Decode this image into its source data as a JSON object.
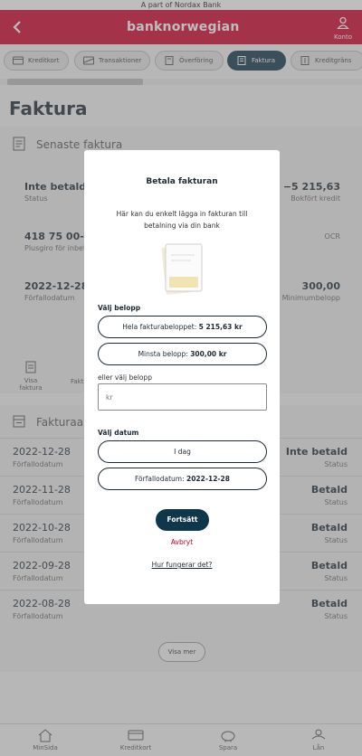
{
  "top_banner": "A part of Nordax Bank",
  "header": {
    "brand": "banknorwegian",
    "account_label": "Konto",
    "brand_color": "#d0002a"
  },
  "tabs": [
    {
      "label": "Kreditkort",
      "icon": "credit-card-icon"
    },
    {
      "label": "Transaktioner",
      "icon": "transactions-icon"
    },
    {
      "label": "Överföring",
      "icon": "transfer-icon"
    },
    {
      "label": "Faktura",
      "icon": "invoice-icon",
      "active": true
    },
    {
      "label": "Kreditgräns",
      "icon": "credit-limit-icon"
    }
  ],
  "page_title": "Faktura",
  "latest_invoice": {
    "title": "Senaste faktura",
    "status_value": "Inte betald",
    "status_label": "Status",
    "booked_value": "−5 215,63",
    "booked_label": "Bokfört kredit",
    "plusgiro_value": "418 75 00-6",
    "plusgiro_label": "Plusgiro för inbetalning",
    "ocr_label": "OCR",
    "due_value": "2022-12-28",
    "due_label": "Förfallodatum",
    "min_value": "300,00",
    "min_label": "Minimumbelopp",
    "action_show": "Visa faktura",
    "action_partial": "Fakt"
  },
  "archive": {
    "title": "Fakturaarkiv",
    "rows": [
      {
        "date": "2022-12-28",
        "date_label": "Förfallodatum",
        "status": "Inte betald",
        "status_label": "Status"
      },
      {
        "date": "2022-11-28",
        "date_label": "Förfallodatum",
        "status": "Betald",
        "status_label": "Status"
      },
      {
        "date": "2022-10-28",
        "date_label": "Förfallodatum",
        "status": "Betald",
        "status_label": "Status"
      },
      {
        "date": "2022-09-28",
        "date_label": "Förfallodatum",
        "status": "Betald",
        "status_label": "Status"
      },
      {
        "date": "2022-08-28",
        "date_label": "Förfallodatum",
        "status": "Betald",
        "status_label": "Status"
      }
    ],
    "show_more": "Visa mer"
  },
  "bottom_nav": [
    {
      "label": "MinSida",
      "icon": "home-icon"
    },
    {
      "label": "Kreditkort",
      "icon": "credit-card-icon"
    },
    {
      "label": "Spara",
      "icon": "piggy-bank-icon"
    },
    {
      "label": "Lån",
      "icon": "loan-icon"
    }
  ],
  "modal": {
    "title": "Betala fakturan",
    "description": "Här kan du enkelt lägga in fakturan till betalning via din bank",
    "choose_amount_label": "Välj belopp",
    "full_amount_prefix": "Hela fakturabeloppet:",
    "full_amount_value": "5 215,63 kr",
    "min_amount_prefix": "Minsta belopp:",
    "min_amount_value": "300,00 kr",
    "or_choose_label": "eller välj belopp",
    "amount_placeholder": "kr",
    "choose_date_label": "Välj datum",
    "today_option": "I dag",
    "due_option_prefix": "Förfallodatum:",
    "due_option_value": "2022-12-28",
    "continue_button": "Fortsätt",
    "cancel_link": "Avbryt",
    "how_link": "Hur fungerar det?"
  }
}
